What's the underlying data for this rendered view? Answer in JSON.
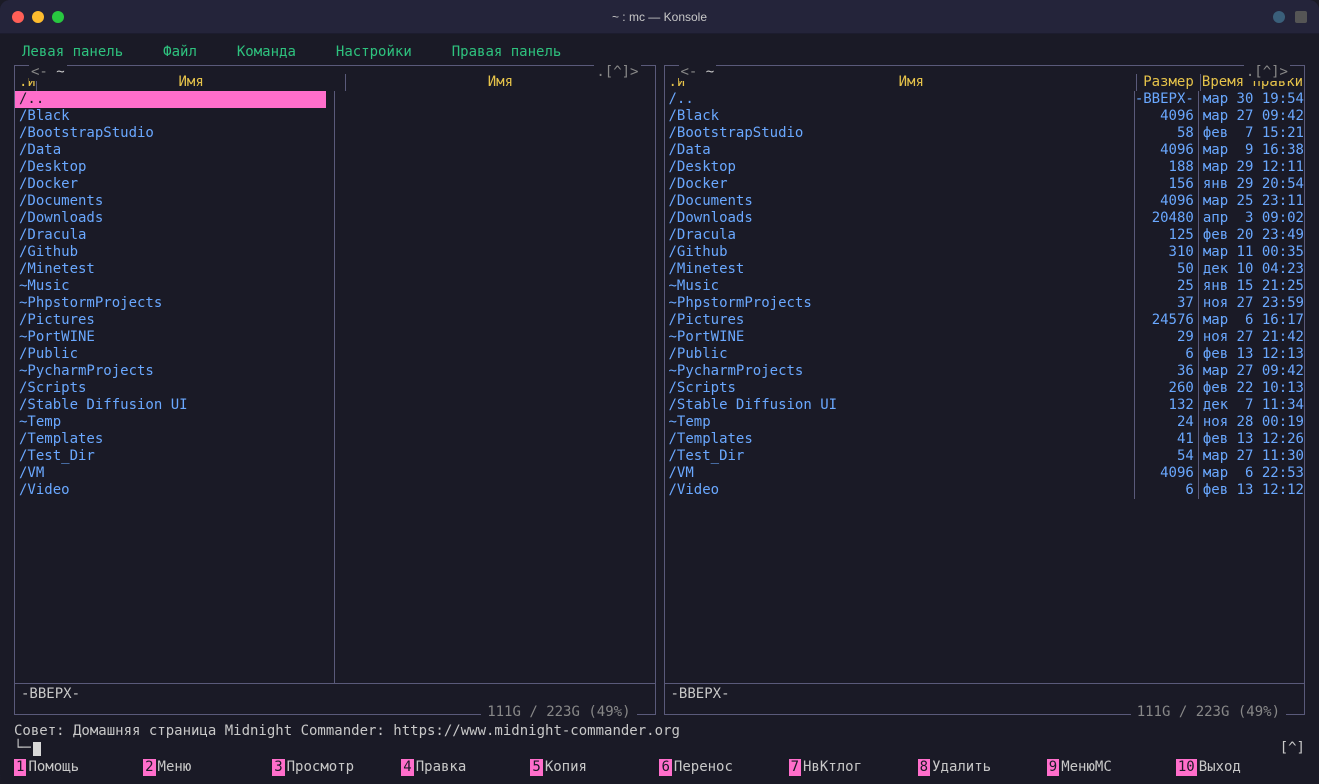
{
  "window": {
    "title": "~ : mc — Konsole"
  },
  "menubar": {
    "items": [
      "Левая панель",
      "Файл",
      "Команда",
      "Настройки",
      "Правая панель"
    ]
  },
  "panel_frame": {
    "left_hint": "<-",
    "tilde": "~",
    "right_hint": ".[^]>"
  },
  "left_panel": {
    "sort_marker": ".и",
    "col_label": "Имя",
    "selected_index": 0,
    "rows": [
      "/..",
      "/Black",
      "/BootstrapStudio",
      "/Data",
      "/Desktop",
      "/Docker",
      "/Documents",
      "/Downloads",
      "/Dracula",
      "/Github",
      "/Minetest",
      "~Music",
      "~PhpstormProjects",
      "/Pictures",
      "~PortWINE",
      "/Public",
      "~PycharmProjects",
      "/Scripts",
      "/Stable Diffusion UI",
      "~Temp",
      "/Templates",
      "/Test_Dir",
      "/VM",
      "/Video"
    ],
    "mini_status": "-ВВЕРХ-",
    "disk": "111G / 223G (49%)"
  },
  "right_panel": {
    "sort_marker": ".и",
    "col_name": "Имя",
    "col_size": "Размер",
    "col_time": "Время правки",
    "rows": [
      {
        "name": "/..",
        "size": "-ВВЕРХ-",
        "time": "мар 30 19:54"
      },
      {
        "name": "/Black",
        "size": "4096",
        "time": "мар 27 09:42"
      },
      {
        "name": "/BootstrapStudio",
        "size": "58",
        "time": "фев  7 15:21"
      },
      {
        "name": "/Data",
        "size": "4096",
        "time": "мар  9 16:38"
      },
      {
        "name": "/Desktop",
        "size": "188",
        "time": "мар 29 12:11"
      },
      {
        "name": "/Docker",
        "size": "156",
        "time": "янв 29 20:54"
      },
      {
        "name": "/Documents",
        "size": "4096",
        "time": "мар 25 23:11"
      },
      {
        "name": "/Downloads",
        "size": "20480",
        "time": "апр  3 09:02"
      },
      {
        "name": "/Dracula",
        "size": "125",
        "time": "фев 20 23:49"
      },
      {
        "name": "/Github",
        "size": "310",
        "time": "мар 11 00:35"
      },
      {
        "name": "/Minetest",
        "size": "50",
        "time": "дек 10 04:23"
      },
      {
        "name": "~Music",
        "size": "25",
        "time": "янв 15 21:25"
      },
      {
        "name": "~PhpstormProjects",
        "size": "37",
        "time": "ноя 27 23:59"
      },
      {
        "name": "/Pictures",
        "size": "24576",
        "time": "мар  6 16:17"
      },
      {
        "name": "~PortWINE",
        "size": "29",
        "time": "ноя 27 21:42"
      },
      {
        "name": "/Public",
        "size": "6",
        "time": "фев 13 12:13"
      },
      {
        "name": "~PycharmProjects",
        "size": "36",
        "time": "мар 27 09:42"
      },
      {
        "name": "/Scripts",
        "size": "260",
        "time": "фев 22 10:13"
      },
      {
        "name": "/Stable Diffusion UI",
        "size": "132",
        "time": "дек  7 11:34"
      },
      {
        "name": "~Temp",
        "size": "24",
        "time": "ноя 28 00:19"
      },
      {
        "name": "/Templates",
        "size": "41",
        "time": "фев 13 12:26"
      },
      {
        "name": "/Test_Dir",
        "size": "54",
        "time": "мар 27 11:30"
      },
      {
        "name": "/VM",
        "size": "4096",
        "time": "мар  6 22:53"
      },
      {
        "name": "/Video",
        "size": "6",
        "time": "фев 13 12:12"
      }
    ],
    "mini_status": "-ВВЕРХ-",
    "disk": "111G / 223G (49%)"
  },
  "hint": "Совет: Домашняя страница Midnight Commander: https://www.midnight-commander.org",
  "prompt": {
    "text": "└─",
    "right": "[^]"
  },
  "fkeys": [
    {
      "n": "1",
      "label": "Помощь"
    },
    {
      "n": "2",
      "label": "Меню"
    },
    {
      "n": "3",
      "label": "Просмотр"
    },
    {
      "n": "4",
      "label": "Правка"
    },
    {
      "n": "5",
      "label": "Копия"
    },
    {
      "n": "6",
      "label": "Перенос"
    },
    {
      "n": "7",
      "label": "НвКтлог"
    },
    {
      "n": "8",
      "label": "Удалить"
    },
    {
      "n": "9",
      "label": "МенюМС"
    },
    {
      "n": "10",
      "label": "Выход"
    }
  ]
}
